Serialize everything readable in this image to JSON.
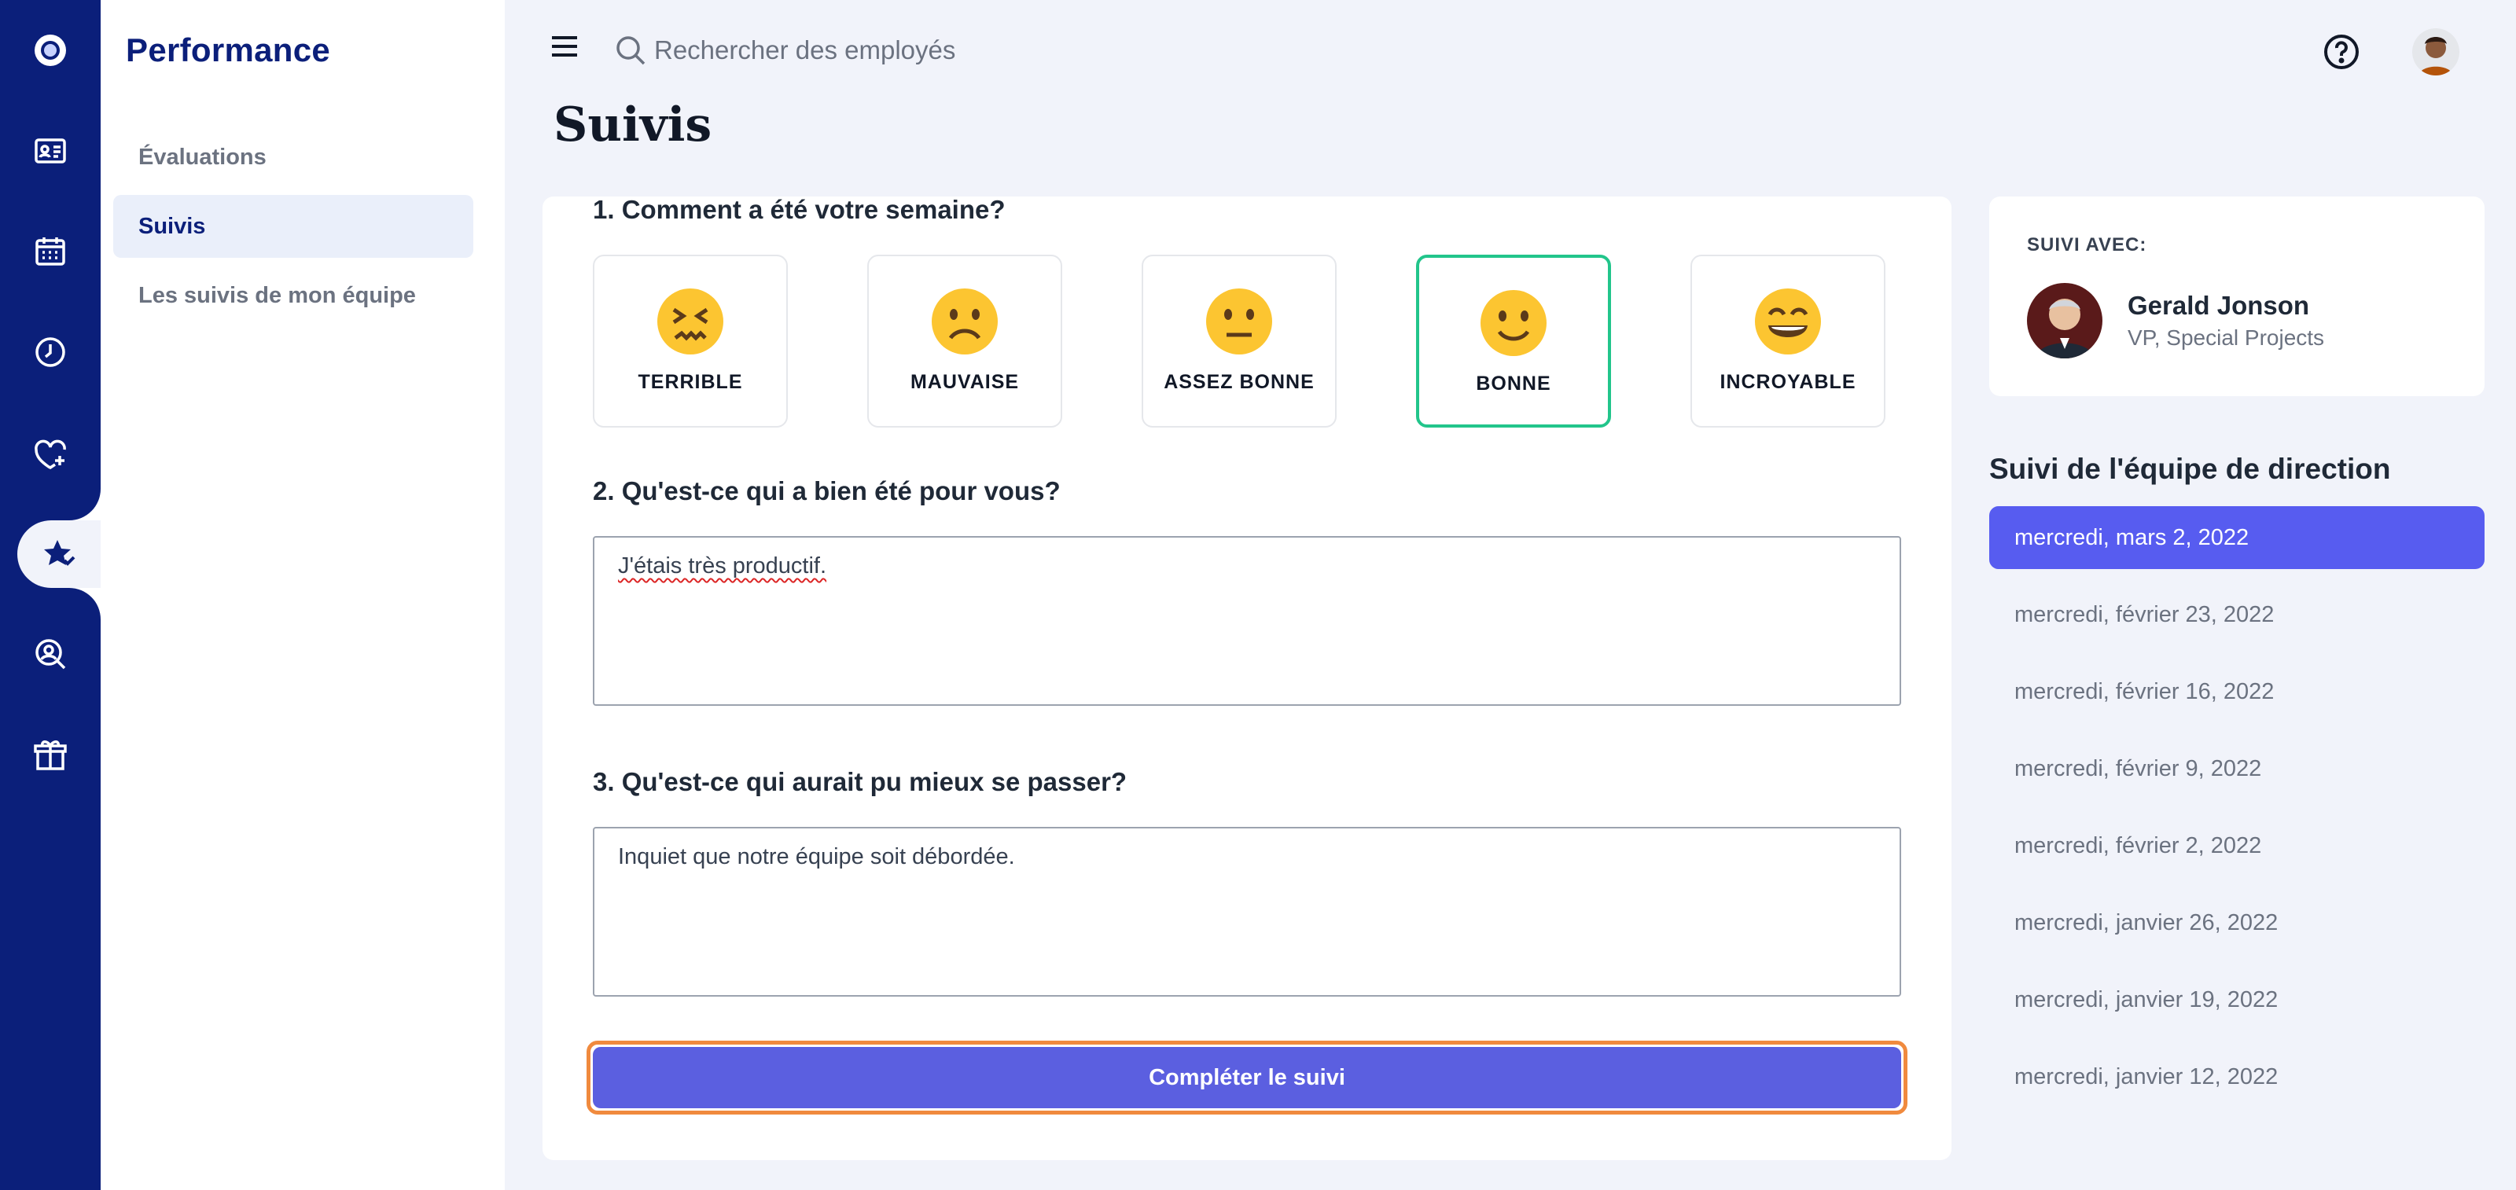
{
  "app": {
    "section_title": "Performance"
  },
  "subnav": {
    "items": [
      {
        "label": "Évaluations",
        "active": false
      },
      {
        "label": "Suivis",
        "active": true
      },
      {
        "label": "Les suivis de mon équipe",
        "active": false
      }
    ]
  },
  "rail": {
    "icons": [
      "logo-icon",
      "id-card-icon",
      "calendar-icon",
      "clock-icon",
      "heart-plus-icon",
      "star-badge-icon",
      "person-search-icon",
      "gift-box-icon"
    ],
    "active_index": 5,
    "accent": "#0b1f7a"
  },
  "header": {
    "search_placeholder": "Rechercher des employés"
  },
  "page": {
    "title": "Suivis"
  },
  "form": {
    "q1": "1. Comment a été votre semaine?",
    "moods": [
      {
        "label": "TERRIBLE",
        "icon": "confounded-face-icon",
        "selected": false
      },
      {
        "label": "MAUVAISE",
        "icon": "slightly-frowning-face-icon",
        "selected": false
      },
      {
        "label": "ASSEZ BONNE",
        "icon": "neutral-face-icon",
        "selected": false
      },
      {
        "label": "BONNE",
        "icon": "slightly-smiling-face-icon",
        "selected": true
      },
      {
        "label": "INCROYABLE",
        "icon": "grinning-squinting-face-icon",
        "selected": false
      }
    ],
    "q2": "2. Qu'est-ce qui a bien été pour vous?",
    "a2": "J'étais très productif.",
    "q3": "3. Qu'est-ce qui aurait pu mieux se passer?",
    "a3": "Inquiet que notre équipe soit débordée.",
    "submit_label": "Compléter le suivi",
    "selected_color": "#22c58b",
    "button_color": "#5b5fe0"
  },
  "with": {
    "label": "SUIVI AVEC:",
    "name": "Gerald Jonson",
    "role": "VP, Special Projects"
  },
  "team": {
    "title": "Suivi de l'équipe de direction",
    "dates": [
      "mercredi, mars 2, 2022",
      "mercredi, février 23, 2022",
      "mercredi, février 16, 2022",
      "mercredi, février 9, 2022",
      "mercredi, février 2, 2022",
      "mercredi, janvier 26, 2022",
      "mercredi, janvier 19, 2022",
      "mercredi, janvier 12, 2022"
    ],
    "active_index": 0,
    "active_color": "#575cf0"
  }
}
